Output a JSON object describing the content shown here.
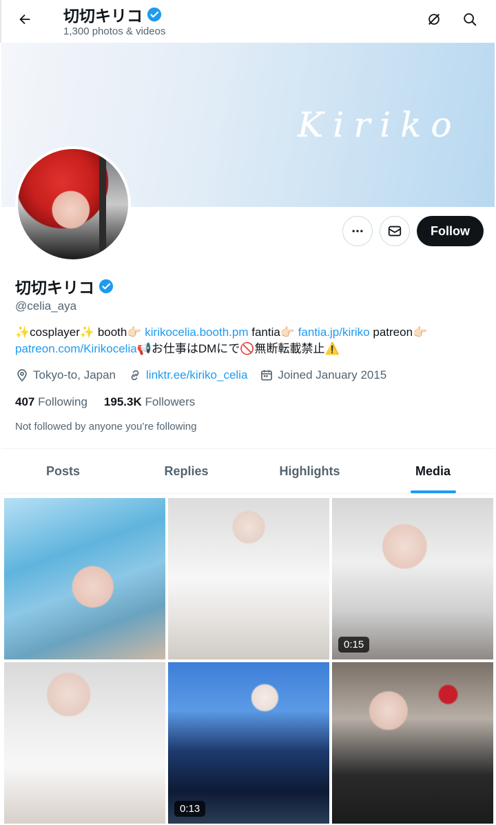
{
  "header": {
    "title": "切切キリコ",
    "subtitle": "1,300 photos & videos"
  },
  "banner": {
    "text": "Kiriko"
  },
  "actions": {
    "follow_label": "Follow"
  },
  "profile": {
    "name": "切切キリコ",
    "handle": "@celia_aya",
    "bio": {
      "part1": "✨cosplayer✨ booth👉🏻 ",
      "link1": "kirikocelia.booth.pm",
      "part2": " fantia👉🏻 ",
      "link2": "fantia.jp/kiriko",
      "part3": " patreon👉🏻 ",
      "link3": "patreon.com/Kirikocelia",
      "part4": "📢お仕事はDMにで🚫無断転載禁止⚠️"
    },
    "location": "Tokyo-to, Japan",
    "website": "linktr.ee/kiriko_celia",
    "joined": "Joined January 2015",
    "following_count": "407",
    "following_label": "Following",
    "followers_count": "195.3K",
    "followers_label": "Followers",
    "not_followed": "Not followed by anyone you’re following"
  },
  "tabs": [
    {
      "label": "Posts"
    },
    {
      "label": "Replies"
    },
    {
      "label": "Highlights"
    },
    {
      "label": "Media"
    }
  ],
  "active_tab": "Media",
  "media": [
    {
      "duration": ""
    },
    {
      "duration": ""
    },
    {
      "duration": "0:15"
    },
    {
      "duration": ""
    },
    {
      "duration": "0:13"
    },
    {
      "duration": ""
    }
  ],
  "colors": {
    "accent": "#1d9bf0",
    "text": "#0f1419",
    "muted": "#536471"
  }
}
